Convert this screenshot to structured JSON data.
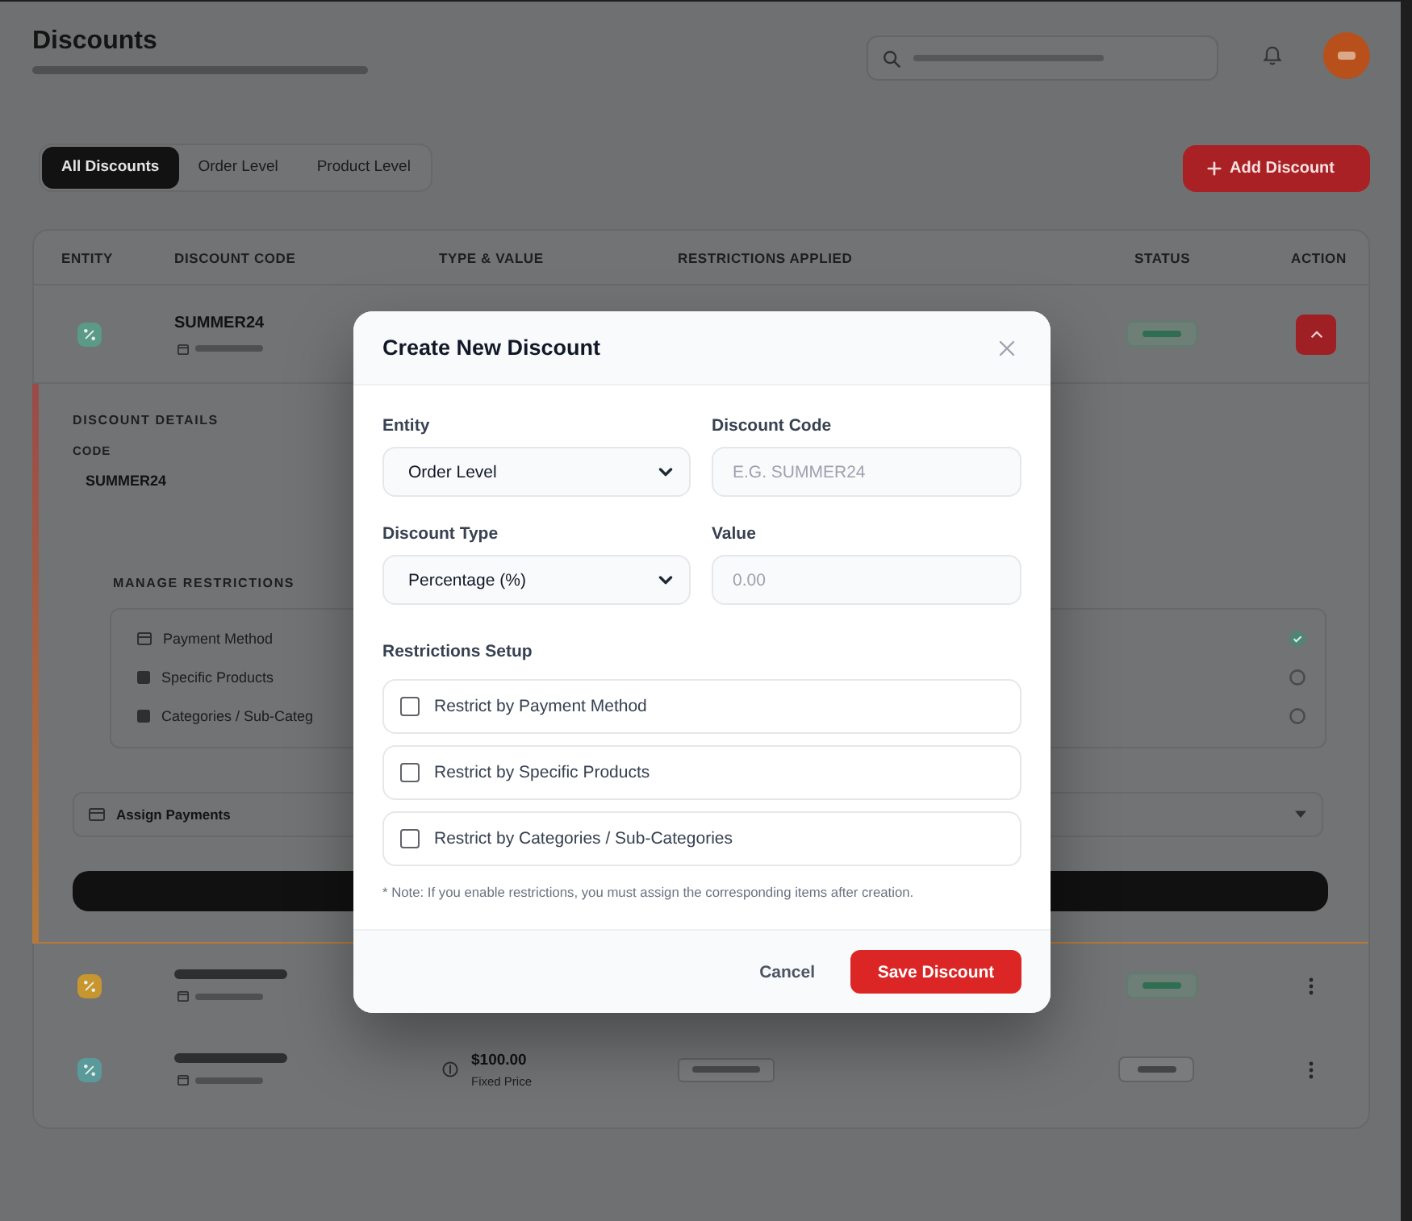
{
  "page": {
    "title": "Discounts",
    "tabs": [
      {
        "label": "All Discounts",
        "selected": true
      },
      {
        "label": "Order Level",
        "selected": false
      },
      {
        "label": "Product Level",
        "selected": false
      }
    ],
    "add_button": "Add Discount"
  },
  "table": {
    "columns": [
      "ENTITY",
      "DISCOUNT CODE",
      "TYPE & VALUE",
      "RESTRICTIONS APPLIED",
      "STATUS",
      "ACTION"
    ],
    "rows": [
      {
        "color": "#5b9a86",
        "code": "SUMMER24",
        "expanded": true,
        "active": true
      },
      {
        "color": "#c8962e",
        "expanded": false,
        "active": true
      },
      {
        "color": "#5b9a9a",
        "value": "$100.00",
        "value_note": "Fixed Price",
        "restrictions_badge": true,
        "expanded": false,
        "active": false
      }
    ],
    "details": {
      "heading": "DISCOUNT DETAILS",
      "code_label": "CODE",
      "code": "SUMMER24",
      "restrictions_heading": "MANAGE RESTRICTIONS",
      "restrictions": [
        {
          "label": "Payment Method",
          "enabled": true
        },
        {
          "label": "Specific Products",
          "enabled": false
        },
        {
          "label": "Categories / Sub-Categ",
          "enabled": false
        }
      ],
      "assign_label": "Assign Payments"
    }
  },
  "modal": {
    "title": "Create New Discount",
    "fields": [
      {
        "label": "Entity",
        "kind": "select",
        "value": "Order Level"
      },
      {
        "label": "Discount Code",
        "kind": "text",
        "placeholder": "E.G. SUMMER24"
      },
      {
        "label": "Discount Type",
        "kind": "select",
        "value": "Percentage (%)"
      },
      {
        "label": "Value",
        "kind": "text",
        "placeholder": "0.00"
      }
    ],
    "restrictions_title": "Restrictions Setup",
    "restrictions": [
      {
        "label": "Restrict by Payment Method",
        "checked": false
      },
      {
        "label": "Restrict by Specific Products",
        "checked": false
      },
      {
        "label": "Restrict by Categories / Sub-Categories",
        "checked": false
      }
    ],
    "note": "* Note: If you enable restrictions, you must assign the corresponding items after creation.",
    "cancel": "Cancel",
    "save": "Save Discount"
  }
}
